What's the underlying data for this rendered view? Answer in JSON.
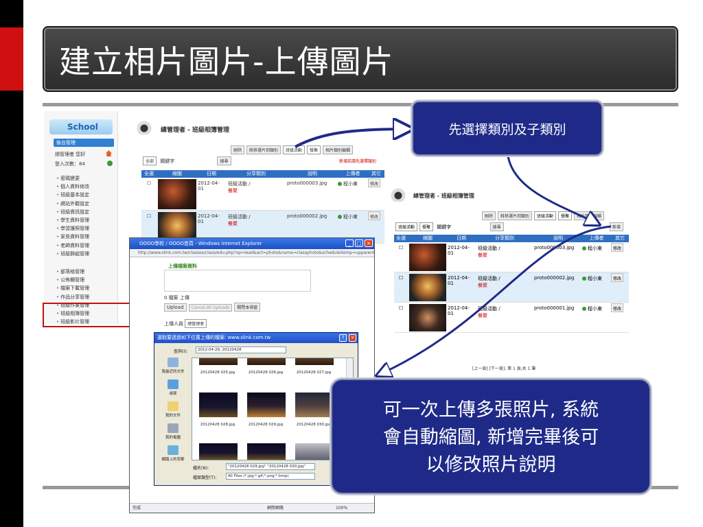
{
  "slide": {
    "title": "建立相片圖片-上傳圖片",
    "callout_top": "先選擇類別及子類別",
    "callout_bottom_lines": [
      "可一次上傳多張照片, 系統",
      "會自動縮圖, 新增完畢後可",
      "以修改照片說明"
    ]
  },
  "sidebar": {
    "logo": "School",
    "admin_button": "後台管理",
    "user_line": "總管理者 您好",
    "login_count": "登入次數：84",
    "menu_group1": [
      "密碼變更",
      "個人資料修改",
      "班級基本設定",
      "網站外觀設定",
      "班級資訊設定",
      "學生資料管理",
      "學習護照管理",
      "家長資料管理",
      "老師資料管理",
      "班級群組管理"
    ],
    "menu_group2": [
      "部落格管理",
      "公佈欄管理",
      "檔案下載管理",
      "作品分享管理",
      "班級作業管理",
      "班級相簿管理",
      "班級影片管理"
    ]
  },
  "main": {
    "header": "總管理者 - 班級相簿管理",
    "toolbar_buttons": [
      "刪除",
      "將移選片到類別"
    ],
    "category_select": "班級活動",
    "subcategory_select": "餐聚",
    "manage_button": "相片類別編輯",
    "filter_all": "全部",
    "filter_keyword": "關鍵字",
    "search_button": "搜尋",
    "hint": "新增前請先選擇類別",
    "columns": [
      "全選",
      "縮圖",
      "日期",
      "分享類別",
      "說明",
      "上傳者",
      "其它"
    ],
    "rows": [
      {
        "date": "2012-04-01",
        "category": "班級活動 /",
        "subcategory": "餐聚",
        "desc": "proto000003.jpg",
        "uploader": "程小東",
        "action": "修改"
      },
      {
        "date": "2012-04-01",
        "category": "班級活動 /",
        "subcategory": "餐聚",
        "desc": "proto000002.jpg",
        "uploader": "程小東",
        "action": "修改"
      }
    ]
  },
  "right_shot": {
    "header": "總管理者 - 班級相簿管理",
    "toolbar_buttons": [
      "刪除",
      "將移選片到類別"
    ],
    "category_select": "班級活動",
    "subcategory_select": "餐聚",
    "manage_button": "相片類別編輯",
    "filter_cat": "班級活動",
    "filter_sub": "餐聚",
    "filter_keyword": "關鍵字",
    "search_button": "搜尋",
    "add_button": "新增",
    "columns": [
      "全選",
      "縮圖",
      "日期",
      "分享類別",
      "說明",
      "上傳者",
      "其它"
    ],
    "rows": [
      {
        "date": "2012-04-01",
        "category": "班級活動 /",
        "subcategory": "餐聚",
        "desc": "proto000003.jpg",
        "uploader": "程小東",
        "action": "修改"
      },
      {
        "date": "2012-04-01",
        "category": "班級活動 /",
        "subcategory": "餐聚",
        "desc": "proto000002.jpg",
        "uploader": "程小東",
        "action": "修改"
      },
      {
        "date": "2012-04-01",
        "category": "班級活動 /",
        "subcategory": "餐聚",
        "desc": "proto000001.jpg",
        "uploader": "程小東",
        "action": "修改"
      }
    ],
    "pager": "[上一頁] [下一頁], 第 1 頁,共 1 筆"
  },
  "ie_window": {
    "title": "OOOO學校 / OOOO首頁 - Windows Internet Explorer",
    "address": "http://www.slink.com.tw/classes/class/edu.php?op=lead&act=photo&name=classphoto&scheduleitemp=upparent&sethhg1_id=0",
    "upload_title": "上傳檔案資料",
    "file_count": "0 檔案 上傳",
    "upload_button": "Upload",
    "cancel_button": "Cancel All Uploads",
    "close_button": "關閉本視窗",
    "uploader_label": "上傳人員",
    "uploader_value": "總管理者",
    "status": "完成",
    "zone": "網際網路",
    "zoom": "100%"
  },
  "file_dialog": {
    "title": "選取要透過如下位置上傳的檔案: www.slink.com.tw",
    "lookin_label": "查詢(I):",
    "lookin_value": "2012-04-29, 20120428",
    "places": [
      "我最近的文件",
      "桌面",
      "我的文件",
      "我的電腦",
      "網路上的芳鄰"
    ],
    "files_row1": [
      "20120428 025.jpg",
      "20120428 026.jpg",
      "20120428 027.jpg"
    ],
    "files_row2": [
      "20120428 028.jpg",
      "20120428 029.jpg",
      "20120428 030.jpg"
    ],
    "filename_label": "檔名(N):",
    "filename_value": "\"20120428 029.jpg\" \"20120428 030.jpg\"",
    "filetype_label": "檔案類型(T):",
    "filetype_value": "All Files (*.jpg;*.gif;*.png;*.bmp)"
  },
  "colors": {
    "callout_bg": "#1f2a88",
    "accent_red": "#d01010",
    "table_head": "#2f6fc2"
  }
}
